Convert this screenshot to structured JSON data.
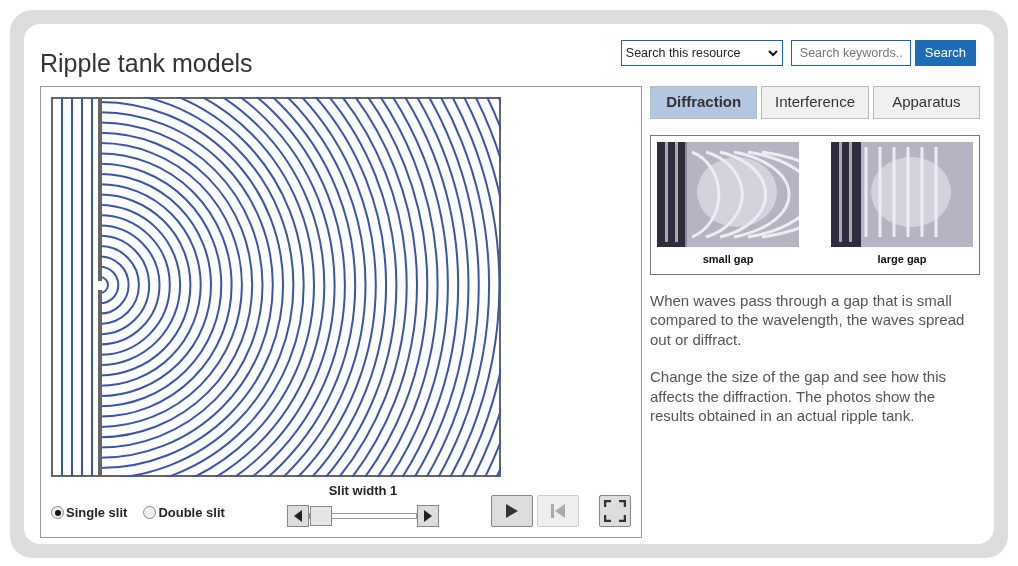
{
  "title": "Ripple tank models",
  "search": {
    "scope": "Search this resource",
    "placeholder": "Search keywords..",
    "button": "Search"
  },
  "tabs": [
    {
      "label": "Diffraction",
      "selected": true
    },
    {
      "label": "Interference",
      "selected": false
    },
    {
      "label": "Apparatus",
      "selected": false
    }
  ],
  "photos": [
    {
      "kind": "picture",
      "caption": "small gap"
    },
    {
      "kind": "picture",
      "caption": "large gap"
    }
  ],
  "paragraphs": [
    "When waves pass through a gap that is small compared to the wavelength, the waves spread out or diffract.",
    "Change the size of the gap and see how this affects the diffraction. The photos show the results obtained in an actual ripple tank."
  ],
  "modes": [
    {
      "label": "Single slit",
      "selected": true
    },
    {
      "label": "Double slit",
      "selected": false
    }
  ],
  "slider": {
    "label": "Slit width 1",
    "level": 0
  },
  "controls": {
    "play_disabled": false,
    "reset_disabled": true
  }
}
